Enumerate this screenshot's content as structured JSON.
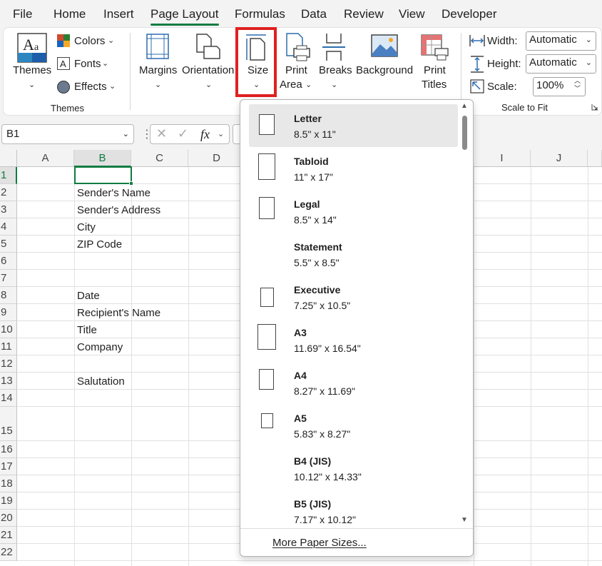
{
  "menu": {
    "tabs": [
      "File",
      "Home",
      "Insert",
      "Page Layout",
      "Formulas",
      "Data",
      "Review",
      "View",
      "Developer"
    ],
    "active": "Page Layout"
  },
  "ribbon": {
    "themes_group": {
      "themes_label": "Themes",
      "colors_label": "Colors",
      "fonts_label": "Fonts",
      "effects_label": "Effects",
      "group_label": "Themes"
    },
    "page_setup": {
      "margins_label": "Margins",
      "orientation_label": "Orientation",
      "size_label": "Size",
      "print_area_label_1": "Print",
      "print_area_label_2": "Area",
      "breaks_label": "Breaks",
      "background_label": "Background",
      "print_titles_label_1": "Print",
      "print_titles_label_2": "Titles"
    },
    "scale_to_fit": {
      "width_label": "Width:",
      "width_value": "Automatic",
      "height_label": "Height:",
      "height_value": "Automatic",
      "scale_label": "Scale:",
      "scale_value": "100%",
      "group_label": "Scale to Fit"
    }
  },
  "formula_bar": {
    "name_box": "B1",
    "fx": "fx"
  },
  "grid": {
    "columns": [
      "A",
      "B",
      "C",
      "D",
      "I",
      "J"
    ],
    "rows": [
      "1",
      "2",
      "3",
      "4",
      "5",
      "6",
      "7",
      "8",
      "9",
      "10",
      "11",
      "12",
      "13",
      "14",
      "15",
      "16",
      "17",
      "18",
      "19",
      "20",
      "21",
      "22"
    ],
    "cells": {
      "B2": "Sender's Name",
      "B3": "Sender's Address",
      "B4": "City",
      "B5": "ZIP Code",
      "B8": "Date",
      "B9": "Recipient's Name",
      "B10": "Title",
      "B11": "Company",
      "B13": "Salutation"
    }
  },
  "size_dropdown": {
    "items": [
      {
        "name": "Letter",
        "dims": "8.5\" x 11\""
      },
      {
        "name": "Tabloid",
        "dims": "11\" x 17\""
      },
      {
        "name": "Legal",
        "dims": "8.5\" x 14\""
      },
      {
        "name": "Statement",
        "dims": "5.5\" x 8.5\""
      },
      {
        "name": "Executive",
        "dims": "7.25\" x 10.5\""
      },
      {
        "name": "A3",
        "dims": "11.69\" x 16.54\""
      },
      {
        "name": "A4",
        "dims": "8.27\" x 11.69\""
      },
      {
        "name": "A5",
        "dims": "5.83\" x 8.27\""
      },
      {
        "name": "B4 (JIS)",
        "dims": "10.12\" x 14.33\""
      },
      {
        "name": "B5 (JIS)",
        "dims": "7.17\" x 10.12\""
      }
    ],
    "more_label": "More Paper Sizes..."
  },
  "colors": {
    "accent_green": "#107c41",
    "highlight_red": "#e02020"
  }
}
